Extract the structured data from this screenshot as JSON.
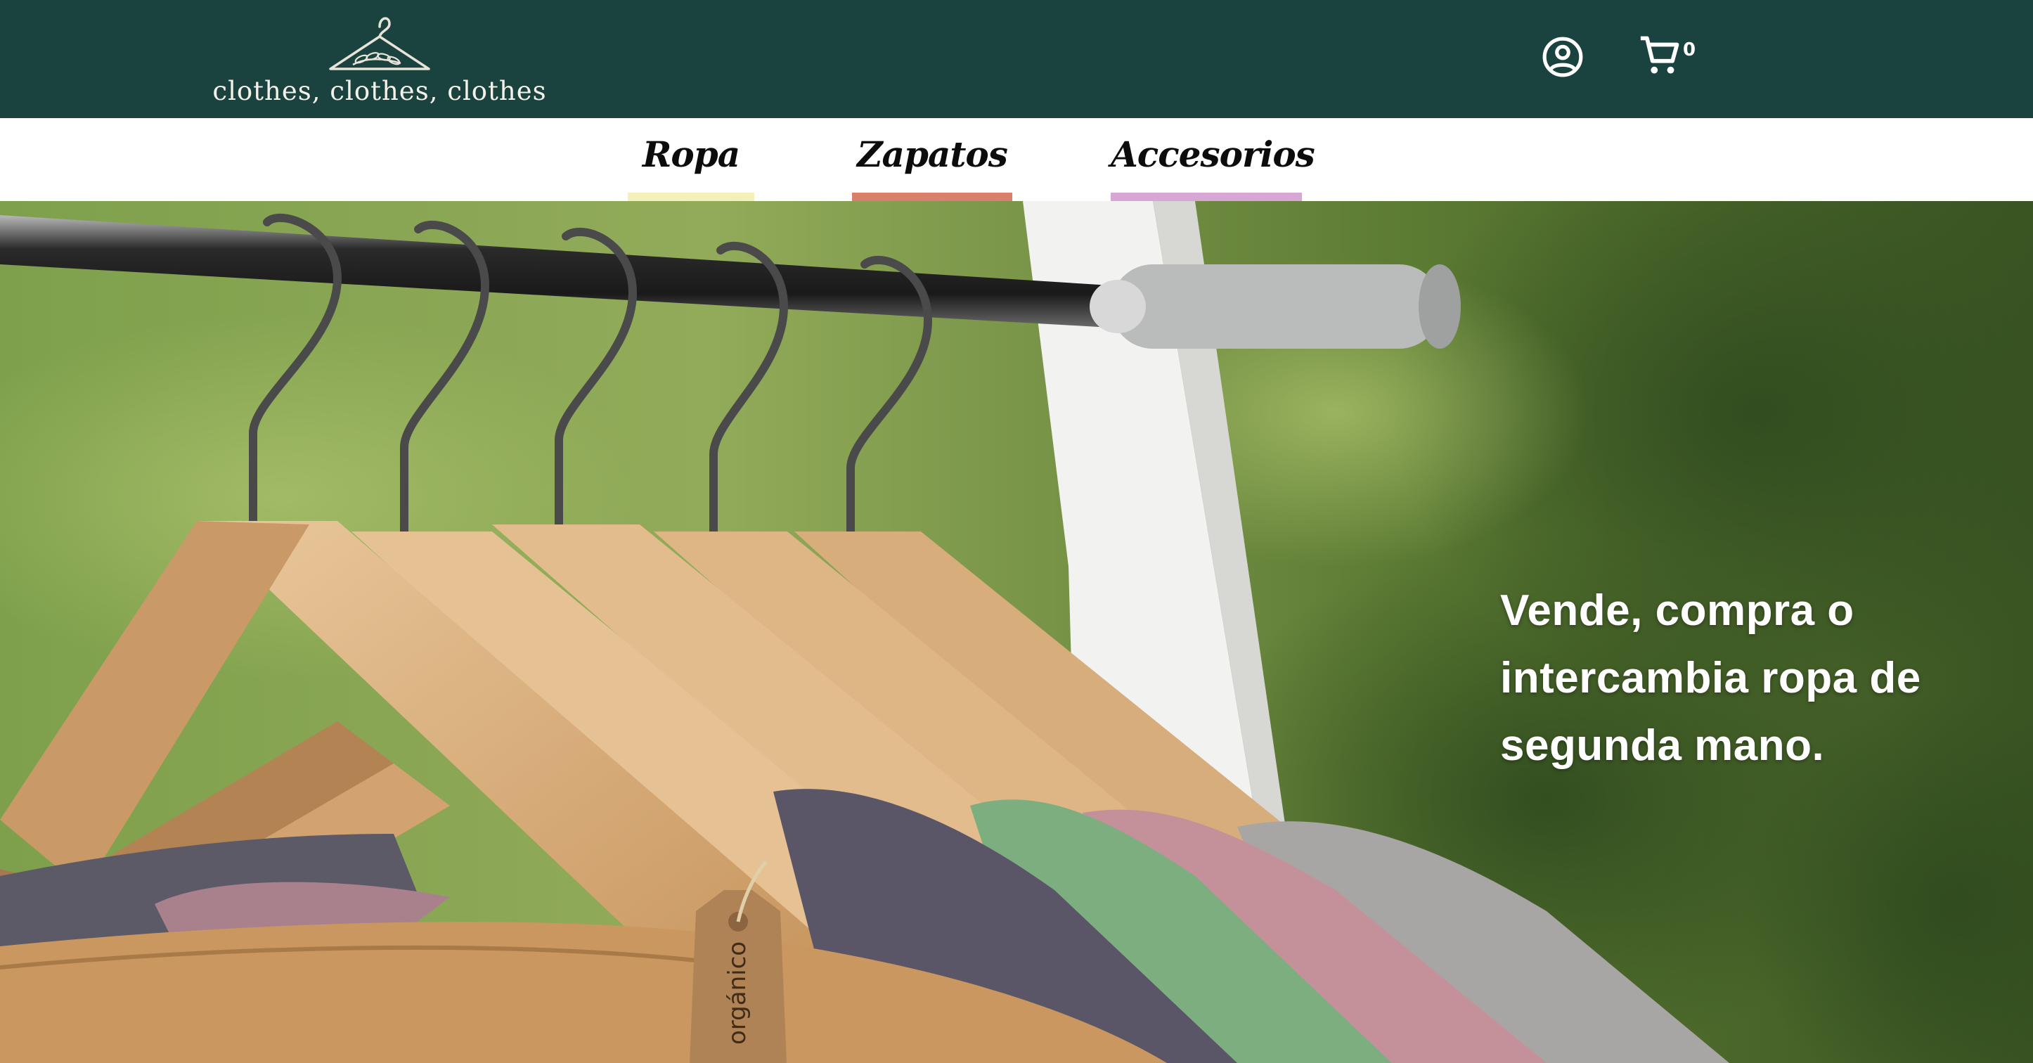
{
  "header": {
    "logo_text": "clothes, clothes, clothes",
    "account_icon": "account-circle-icon",
    "cart_icon": "shopping-cart-icon",
    "cart_count": "0"
  },
  "nav": {
    "categories": [
      {
        "label": "Ropa",
        "accent": "#f5f0b8"
      },
      {
        "label": "Zapatos",
        "accent": "#d8806c"
      },
      {
        "label": "Accesorios",
        "accent": "#d8a6d4"
      }
    ]
  },
  "hero": {
    "headline": "Vende, compra o intercambia ropa de segunda mano.",
    "tag_text": "orgánico"
  },
  "colors": {
    "topbar": "#1a423e",
    "nav_background": "#ffffff"
  }
}
